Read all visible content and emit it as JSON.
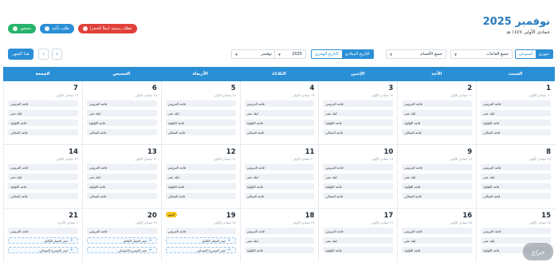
{
  "header": {
    "title": "نوفمبر 2025",
    "subtitle": "جمادى الأولى ١٤٤٧ هـ"
  },
  "status_buttons": [
    {
      "label": "محجوز",
      "color": "#27b36b"
    },
    {
      "label": "طلب تأكيد",
      "color": "#2b8fd6"
    },
    {
      "label": "عطلة رسمية (مثلاً للحجز)",
      "color": "#e0403a"
    }
  ],
  "filters": {
    "view_week": "أسبوعي",
    "view_month": "شهري",
    "halls": "جميع القاعات",
    "sections": "جميع الأقسام",
    "date_gregorian": "التاريخ الميلادي",
    "date_hijri": "التاريخ الهجري",
    "year": "2025",
    "month": "نوفمبر",
    "today": "هذا الشهر"
  },
  "weekdays": [
    "السبت",
    "الأحد",
    "الإثنين",
    "الثلاثاء",
    "الأربعاء",
    "الخميس",
    "الجمعة"
  ],
  "weeks": [
    [
      {
        "num": "1",
        "hijri": "١٠ جمادى الأولى",
        "events": [
          "قاعة العروس",
          "ليلة عمر",
          "قاعة اللؤلؤة",
          "قاعة المعالي"
        ]
      },
      {
        "num": "2",
        "hijri": "١١ جمادى الأولى",
        "events": [
          "قاعة العروس",
          "ليلة عمر",
          "قاعة اللؤلؤة",
          "قاعة المعالي"
        ]
      },
      {
        "num": "3",
        "hijri": "١٢ جمادى الأولى",
        "events": [
          "قاعة العروس",
          "ليلة عمر",
          "قاعة اللؤلؤة",
          "قاعة المعالي"
        ]
      },
      {
        "num": "4",
        "hijri": "١٣ جمادى الأولى",
        "events": [
          "قاعة العروس",
          "ليلة عمر",
          "قاعة اللؤلؤة",
          "قاعة المعالي"
        ]
      },
      {
        "num": "5",
        "hijri": "١٤ جمادى الأولى",
        "events": [
          "قاعة العروس",
          "ليلة عمر",
          "قاعة اللؤلؤة",
          "قاعة المعالي"
        ]
      },
      {
        "num": "6",
        "hijri": "١٥ جمادى الأولى",
        "events": [
          "قاعة العروس",
          "ليلة عمر",
          "قاعة اللؤلؤة",
          "قاعة المعالي"
        ]
      },
      {
        "num": "7",
        "hijri": "١٦ جمادى الأولى",
        "events": [
          "قاعة العروس",
          "ليلة عمر",
          "قاعة اللؤلؤة",
          "قاعة المعالي"
        ]
      }
    ],
    [
      {
        "num": "8",
        "hijri": "١٧ جمادى الأولى",
        "events": [
          "قاعة العروس",
          "ليلة عمر",
          "قاعة اللؤلؤة",
          "قاعة المعالي"
        ]
      },
      {
        "num": "9",
        "hijri": "١٨ جمادى الأولى",
        "events": [
          "قاعة العروس",
          "ليلة عمر",
          "قاعة اللؤلؤة",
          "قاعة المعالي"
        ]
      },
      {
        "num": "10",
        "hijri": "١٩ جمادى الأولى",
        "events": [
          "قاعة العروس",
          "ليلة عمر",
          "قاعة اللؤلؤة",
          "قاعة المعالي"
        ]
      },
      {
        "num": "11",
        "hijri": "٢٠ جمادى الأولى",
        "events": [
          "قاعة العروس",
          "ليلة عمر",
          "قاعة اللؤلؤة",
          "قاعة المعالي"
        ]
      },
      {
        "num": "12",
        "hijri": "٢١ جمادى الأولى",
        "events": [
          "قاعة العروس",
          "ليلة عمر",
          "قاعة اللؤلؤة",
          "قاعة المعالي"
        ]
      },
      {
        "num": "13",
        "hijri": "٢٢ جمادى الأولى",
        "events": [
          "قاعة العروس",
          "ليلة عمر",
          "قاعة اللؤلؤة",
          "قاعة المعالي"
        ]
      },
      {
        "num": "14",
        "hijri": "٢٣ جمادى الأولى",
        "events": [
          "قاعة العروس",
          "ليلة عمر",
          "قاعة اللؤلؤة",
          "قاعة المعالي"
        ]
      }
    ],
    [
      {
        "num": "15",
        "hijri": "٢٤ جمادى الأولى",
        "events": [
          "قاعة العروس",
          "ليلة عمر",
          "قاعة اللؤلؤة"
        ]
      },
      {
        "num": "16",
        "hijri": "٢٥ جمادى الأولى",
        "events": [
          "قاعة العروس",
          "ليلة عمر",
          "قاعة اللؤلؤة"
        ]
      },
      {
        "num": "17",
        "hijri": "٢٦ جمادى الأولى",
        "events": [
          "قاعة العروس",
          "ليلة عمر",
          "قاعة اللؤلؤة"
        ]
      },
      {
        "num": "18",
        "hijri": "٢٧ جمادى الأولى",
        "events": [
          "قاعة العروس",
          "ليلة عمر",
          "قاعة اللؤلؤة"
        ]
      },
      {
        "num": "19",
        "hijri": "٢٨ جمادى الأولى",
        "badge": "اليوم",
        "events": [
          "قاعة العروس",
          "حجز الحفل الكامل",
          "حجز المسرح المسائي"
        ],
        "dashed": [
          1,
          2
        ]
      },
      {
        "num": "20",
        "hijri": "٢٩ جمادى الأولى",
        "events": [
          "قاعة العروس",
          "حجز الحفل الكامل",
          "حجز المسرح المسائي"
        ],
        "dashed": [
          1,
          2
        ]
      },
      {
        "num": "21",
        "hijri": "١ جمادى الآخرة",
        "events": [
          "قاعة العروس",
          "حجز الحفل الكامل",
          "حجز المسرح المسائي"
        ],
        "dashed": [
          1,
          2
        ]
      }
    ]
  ],
  "watermark": "حراج"
}
